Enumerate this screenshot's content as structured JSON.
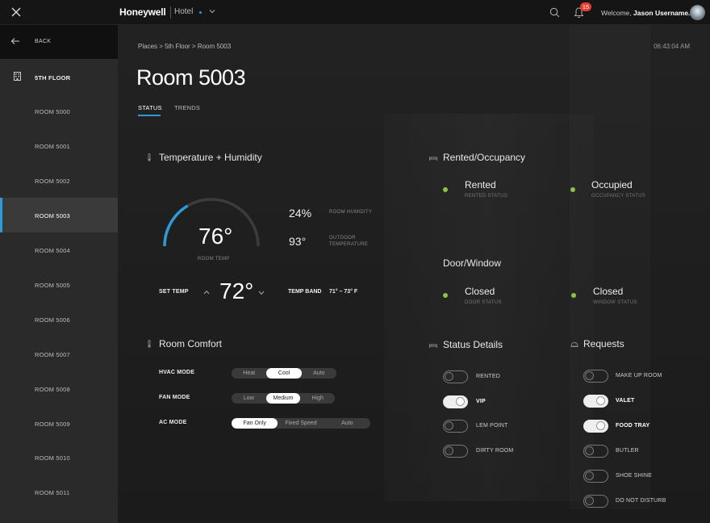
{
  "header": {
    "brand": "Honeywell",
    "product": "Hotel",
    "notification_count": "15",
    "welcome_prefix": "Welcome,",
    "username": "Jason Username."
  },
  "sidebar": {
    "back_label": "BACK",
    "floor_label": "5TH FLOOR",
    "rooms": [
      "ROOM 5000",
      "ROOM 5001",
      "ROOM 5002",
      "ROOM 5003",
      "ROOM 5004",
      "ROOM 5005",
      "ROOM 5006",
      "ROOM 5007",
      "ROOM 5008",
      "ROOM 5009",
      "ROOM 5010",
      "ROOM 5011"
    ],
    "active_room": "ROOM 5003"
  },
  "main": {
    "breadcrumb": "Places > 5th Floor > Room 5003",
    "time": "06:43:04 AM",
    "title": "Room 5003",
    "tabs": [
      "STATUS",
      "TRENDS"
    ],
    "active_tab": "STATUS"
  },
  "temperature": {
    "title": "Temperature + Humidity",
    "room_temp": "76°",
    "room_temp_label": "ROOM TEMP",
    "gauge_fraction": 0.33,
    "humidity_value": "24%",
    "humidity_label": "ROOM HUMIDITY",
    "outdoor_value": "93°",
    "outdoor_label_1": "OUTDOOR",
    "outdoor_label_2": "TEMPERATURE",
    "set_temp_label": "SET TEMP",
    "set_temp_value": "72°",
    "temp_band_label": "TEMP BAND",
    "temp_band_value": "71° – 73° F"
  },
  "comfort": {
    "title": "Room Comfort",
    "hvac_label": "HVAC MODE",
    "hvac_options": [
      "Heat",
      "Cool",
      "Auto"
    ],
    "hvac_selected": "Cool",
    "fan_label": "FAN MODE",
    "fan_options": [
      "Low",
      "Medium",
      "High"
    ],
    "fan_selected": "Medium",
    "ac_label": "AC MODE",
    "ac_options": [
      "Fan Only",
      "Fixed Speed",
      "Auto"
    ],
    "ac_selected": "Fan Only"
  },
  "occupancy": {
    "title": "Rented/Occupancy",
    "rented_value": "Rented",
    "rented_label": "RENTED STATUS",
    "occupied_value": "Occupied",
    "occupied_label": "OCCUPANCY STATUS"
  },
  "door_window": {
    "title": "Door/Window",
    "door_value": "Closed",
    "door_label": "DOOR STATUS",
    "window_value": "Closed",
    "window_label": "WINDOW STATUS"
  },
  "status_details": {
    "title": "Status Details",
    "items": [
      {
        "label": "RENTED",
        "on": false
      },
      {
        "label": "VIP",
        "on": true
      },
      {
        "label": "LEM POINT",
        "on": false
      },
      {
        "label": "DIRTY ROOM",
        "on": false
      }
    ]
  },
  "requests": {
    "title": "Requests",
    "items": [
      {
        "label": "MAKE UP ROOM",
        "on": false
      },
      {
        "label": "VALET",
        "on": true
      },
      {
        "label": "FOOD TRAY",
        "on": true
      },
      {
        "label": "BUTLER",
        "on": false
      },
      {
        "label": "SHOE SHINE",
        "on": false
      },
      {
        "label": "DO NOT DISTURB",
        "on": false
      }
    ]
  },
  "colors": {
    "accent": "#2e9ad8",
    "status_green": "#8bc34a",
    "badge_red": "#e53b2e"
  }
}
